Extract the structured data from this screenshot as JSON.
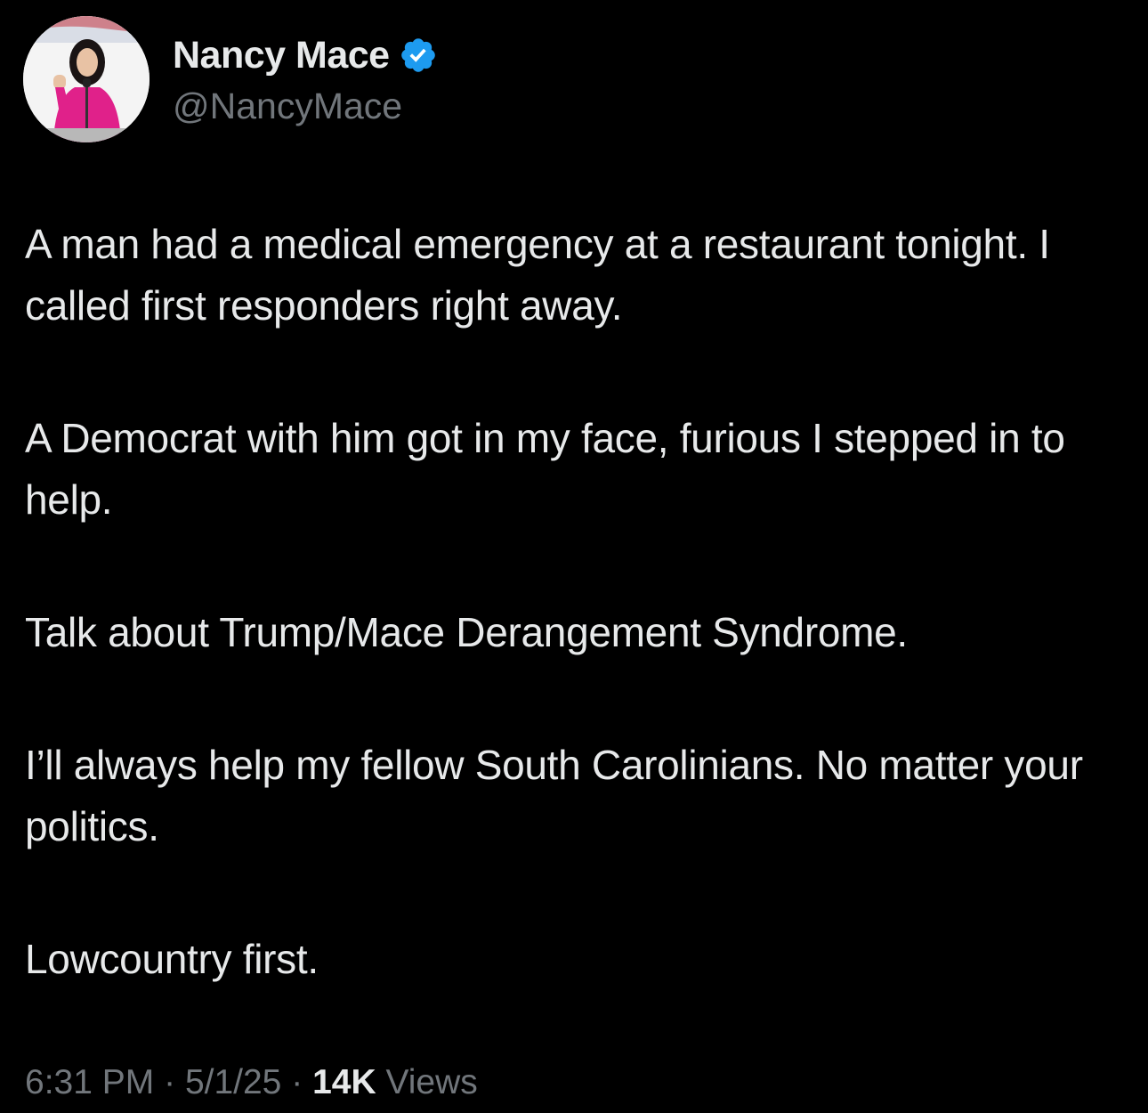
{
  "author": {
    "display_name": "Nancy Mace",
    "handle": "@NancyMace",
    "verified": true,
    "verified_color": "#1d9bf0"
  },
  "tweet": {
    "paragraphs": [
      "A man had a medical emergency at a restaurant tonight. I called first responders right away.",
      "A Democrat with him got in my face, furious I stepped in to help.",
      "Talk about Trump/Mace Derangement Syndrome.",
      "I’ll always help my fellow South Carolinians. No matter your politics.",
      "Lowcountry first."
    ]
  },
  "meta": {
    "time": "6:31 PM",
    "separator": "·",
    "date": "5/1/25",
    "views_count": "14K",
    "views_label": "Views"
  },
  "colors": {
    "background": "#000000",
    "primary_text": "#e7e9ea",
    "secondary_text": "#71767b",
    "avatar_outfit": "#e0218a"
  }
}
